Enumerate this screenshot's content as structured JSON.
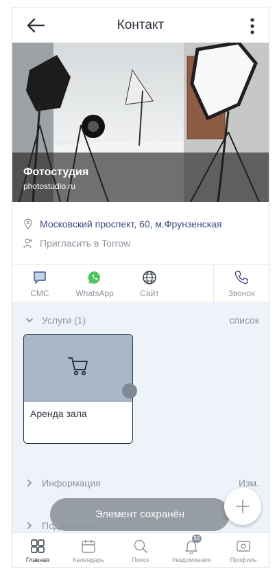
{
  "header": {
    "title": "Контакт"
  },
  "hero": {
    "name": "Фотостудия",
    "site": "photostudio.ru"
  },
  "info": {
    "address": "Московский проспект, 60, м.Фрунзенская",
    "invite": "Пригласить в Torrow"
  },
  "actions": [
    {
      "label": "СМС",
      "icon": "sms-icon"
    },
    {
      "label": "WhatsApp",
      "icon": "whatsapp-icon"
    },
    {
      "label": "Сайт",
      "icon": "globe-icon"
    },
    {
      "label": "Звонок",
      "icon": "phone-icon"
    }
  ],
  "services": {
    "title": "Услуги (1)",
    "right": "список",
    "card_label": "Аренда зала"
  },
  "information": {
    "title": "Информация",
    "right": "Изм."
  },
  "subscribers": {
    "title": "Подписчики"
  },
  "toast": {
    "text": "Элемент сохранён"
  },
  "tabbar": {
    "items": [
      {
        "label": "Главная",
        "icon": "home-grid-icon"
      },
      {
        "label": "Календарь",
        "icon": "calendar-icon"
      },
      {
        "label": "Поиск",
        "icon": "search-icon"
      },
      {
        "label": "Уведомления",
        "icon": "bell-icon",
        "badge": "52"
      },
      {
        "label": "Профиль",
        "icon": "profile-icon"
      }
    ]
  },
  "colors": {
    "accent": "#3b4a8a",
    "card_top": "#aab7c8",
    "content_bg": "#eef3fa"
  }
}
